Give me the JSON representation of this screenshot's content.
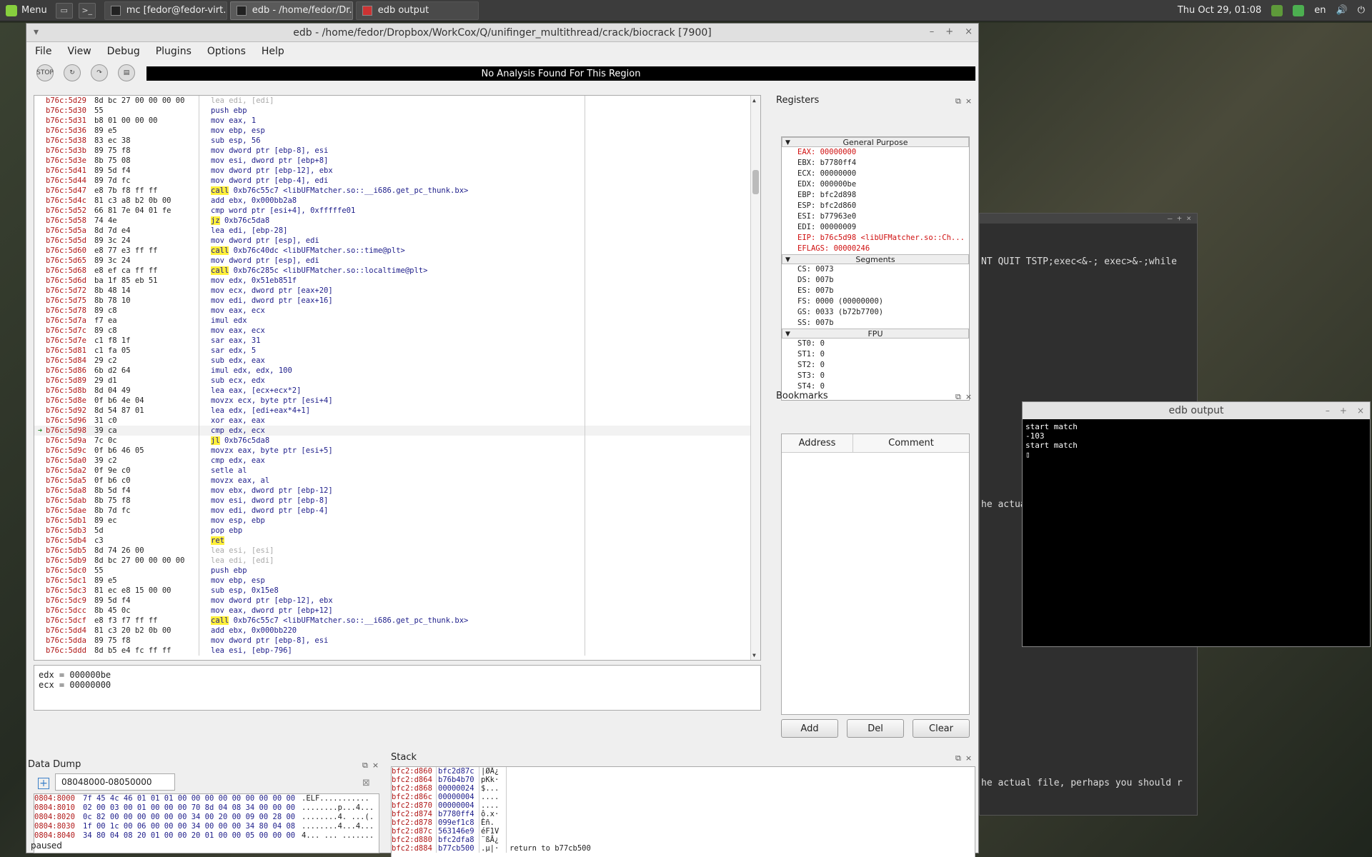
{
  "panel": {
    "menu_label": "Menu",
    "tasks": [
      "mc [fedor@fedor-virt...",
      "edb - /home/fedor/Dr...",
      "edb output"
    ],
    "clock": "Thu Oct 29, 01:08",
    "lang": "en"
  },
  "edb": {
    "title": "edb - /home/fedor/Dropbox/WorkCox/Q/unifinger_multithread/crack/biocrack [7900]",
    "menus": [
      "File",
      "View",
      "Debug",
      "Plugins",
      "Options",
      "Help"
    ],
    "analysis": "No Analysis Found For This Region",
    "disasm": [
      {
        "a": "b76c:5d29",
        "b": "8d bc 27 00 00 00 00",
        "i": "lea edi, [edi]",
        "s": "gray"
      },
      {
        "a": "b76c:5d30",
        "b": "55",
        "i": "push ebp"
      },
      {
        "a": "b76c:5d31",
        "b": "b8 01 00 00 00",
        "i": "mov eax, 1"
      },
      {
        "a": "b76c:5d36",
        "b": "89 e5",
        "i": "mov ebp, esp"
      },
      {
        "a": "b76c:5d38",
        "b": "83 ec 38",
        "i": "sub esp, 56"
      },
      {
        "a": "b76c:5d3b",
        "b": "89 75 f8",
        "i": "mov dword ptr [ebp-8], esi"
      },
      {
        "a": "b76c:5d3e",
        "b": "8b 75 08",
        "i": "mov esi, dword ptr [ebp+8]"
      },
      {
        "a": "b76c:5d41",
        "b": "89 5d f4",
        "i": "mov dword ptr [ebp-12], ebx"
      },
      {
        "a": "b76c:5d44",
        "b": "89 7d fc",
        "i": "mov dword ptr [ebp-4], edi"
      },
      {
        "a": "b76c:5d47",
        "b": "e8 7b f8 ff ff",
        "i": "call",
        "r": " 0xb76c55c7 <libUFMatcher.so::__i686.get_pc_thunk.bx>",
        "s": "hl"
      },
      {
        "a": "b76c:5d4c",
        "b": "81 c3 a8 b2 0b 00",
        "i": "add ebx, 0x000bb2a8"
      },
      {
        "a": "b76c:5d52",
        "b": "66 81 7e 04 01 fe",
        "i": "cmp word ptr [esi+4], 0xfffffe01"
      },
      {
        "a": "b76c:5d58",
        "b": "74 4e",
        "i": "jz",
        "r": " 0xb76c5da8",
        "s": "hl"
      },
      {
        "a": "b76c:5d5a",
        "b": "8d 7d e4",
        "i": "lea edi, [ebp-28]"
      },
      {
        "a": "b76c:5d5d",
        "b": "89 3c 24",
        "i": "mov dword ptr [esp], edi"
      },
      {
        "a": "b76c:5d60",
        "b": "e8 77 e3 ff ff",
        "i": "call",
        "r": " 0xb76c40dc <libUFMatcher.so::time@plt>",
        "s": "hl"
      },
      {
        "a": "b76c:5d65",
        "b": "89 3c 24",
        "i": "mov dword ptr [esp], edi"
      },
      {
        "a": "b76c:5d68",
        "b": "e8 ef ca ff ff",
        "i": "call",
        "r": " 0xb76c285c <libUFMatcher.so::localtime@plt>",
        "s": "hl"
      },
      {
        "a": "b76c:5d6d",
        "b": "ba 1f 85 eb 51",
        "i": "mov edx, 0x51eb851f"
      },
      {
        "a": "b76c:5d72",
        "b": "8b 48 14",
        "i": "mov ecx, dword ptr [eax+20]"
      },
      {
        "a": "b76c:5d75",
        "b": "8b 78 10",
        "i": "mov edi, dword ptr [eax+16]"
      },
      {
        "a": "b76c:5d78",
        "b": "89 c8",
        "i": "mov eax, ecx"
      },
      {
        "a": "b76c:5d7a",
        "b": "f7 ea",
        "i": "imul edx"
      },
      {
        "a": "b76c:5d7c",
        "b": "89 c8",
        "i": "mov eax, ecx"
      },
      {
        "a": "b76c:5d7e",
        "b": "c1 f8 1f",
        "i": "sar eax, 31"
      },
      {
        "a": "b76c:5d81",
        "b": "c1 fa 05",
        "i": "sar edx, 5"
      },
      {
        "a": "b76c:5d84",
        "b": "29 c2",
        "i": "sub edx, eax"
      },
      {
        "a": "b76c:5d86",
        "b": "6b d2 64",
        "i": "imul edx, edx, 100"
      },
      {
        "a": "b76c:5d89",
        "b": "29 d1",
        "i": "sub ecx, edx"
      },
      {
        "a": "b76c:5d8b",
        "b": "8d 04 49",
        "i": "lea eax, [ecx+ecx*2]"
      },
      {
        "a": "b76c:5d8e",
        "b": "0f b6 4e 04",
        "i": "movzx ecx, byte ptr [esi+4]"
      },
      {
        "a": "b76c:5d92",
        "b": "8d 54 87 01",
        "i": "lea edx, [edi+eax*4+1]"
      },
      {
        "a": "b76c:5d96",
        "b": "31 c0",
        "i": "xor eax, eax"
      },
      {
        "a": "b76c:5d98",
        "b": "39 ca",
        "i": "cmp edx, ecx",
        "cur": true
      },
      {
        "a": "b76c:5d9a",
        "b": "7c 0c",
        "i": "jl",
        "r": " 0xb76c5da8",
        "s": "hl"
      },
      {
        "a": "b76c:5d9c",
        "b": "0f b6 46 05",
        "i": "movzx eax, byte ptr [esi+5]"
      },
      {
        "a": "b76c:5da0",
        "b": "39 c2",
        "i": "cmp edx, eax"
      },
      {
        "a": "b76c:5da2",
        "b": "0f 9e c0",
        "i": "setle al"
      },
      {
        "a": "b76c:5da5",
        "b": "0f b6 c0",
        "i": "movzx eax, al"
      },
      {
        "a": "b76c:5da8",
        "b": "8b 5d f4",
        "i": "mov ebx, dword ptr [ebp-12]"
      },
      {
        "a": "b76c:5dab",
        "b": "8b 75 f8",
        "i": "mov esi, dword ptr [ebp-8]"
      },
      {
        "a": "b76c:5dae",
        "b": "8b 7d fc",
        "i": "mov edi, dword ptr [ebp-4]"
      },
      {
        "a": "b76c:5db1",
        "b": "89 ec",
        "i": "mov esp, ebp"
      },
      {
        "a": "b76c:5db3",
        "b": "5d",
        "i": "pop ebp"
      },
      {
        "a": "b76c:5db4",
        "b": "c3",
        "i": "ret",
        "r": "",
        "s": "hl"
      },
      {
        "a": "b76c:5db5",
        "b": "8d 74 26 00",
        "i": "lea esi, [esi]",
        "s": "gray"
      },
      {
        "a": "b76c:5db9",
        "b": "8d bc 27 00 00 00 00",
        "i": "lea edi, [edi]",
        "s": "gray"
      },
      {
        "a": "b76c:5dc0",
        "b": "55",
        "i": "push ebp"
      },
      {
        "a": "b76c:5dc1",
        "b": "89 e5",
        "i": "mov ebp, esp"
      },
      {
        "a": "b76c:5dc3",
        "b": "81 ec e8 15 00 00",
        "i": "sub esp, 0x15e8"
      },
      {
        "a": "b76c:5dc9",
        "b": "89 5d f4",
        "i": "mov dword ptr [ebp-12], ebx"
      },
      {
        "a": "b76c:5dcc",
        "b": "8b 45 0c",
        "i": "mov eax, dword ptr [ebp+12]"
      },
      {
        "a": "b76c:5dcf",
        "b": "e8 f3 f7 ff ff",
        "i": "call",
        "r": " 0xb76c55c7 <libUFMatcher.so::__i686.get_pc_thunk.bx>",
        "s": "hl"
      },
      {
        "a": "b76c:5dd4",
        "b": "81 c3 20 b2 0b 00",
        "i": "add ebx, 0x000bb220"
      },
      {
        "a": "b76c:5dda",
        "b": "89 75 f8",
        "i": "mov dword ptr [ebp-8], esi"
      },
      {
        "a": "b76c:5ddd",
        "b": "8d b5 e4 fc ff ff",
        "i": "lea esi, [ebp-796]"
      }
    ],
    "regs_text": [
      "edx = 000000be",
      "ecx = 00000000"
    ],
    "registers_title": "Registers",
    "groups": {
      "gp": "General Purpose",
      "seg": "Segments",
      "fpu": "FPU"
    },
    "gp": [
      {
        "t": "EAX: 00000000",
        "red": true
      },
      {
        "t": "EBX: b7780ff4"
      },
      {
        "t": "ECX: 00000000"
      },
      {
        "t": "EDX: 000000be"
      },
      {
        "t": "EBP: bfc2d898"
      },
      {
        "t": "ESP: bfc2d860"
      },
      {
        "t": "ESI: b77963e0"
      },
      {
        "t": "EDI: 00000009"
      },
      {
        "t": "EIP: b76c5d98 <libUFMatcher.so::Ch...",
        "red": true
      },
      {
        "t": "EFLAGS: 00000246",
        "red": true
      }
    ],
    "segs": [
      "CS: 0073",
      "DS: 007b",
      "ES: 007b",
      "FS: 0000 (00000000)",
      "GS: 0033 (b72b7700)",
      "SS: 007b"
    ],
    "fpu": [
      "ST0: 0",
      "ST1: 0",
      "ST2: 0",
      "ST3: 0",
      "ST4: 0"
    ],
    "bookmarks_title": "Bookmarks",
    "bm_cols": [
      "Address",
      "Comment"
    ],
    "bm_buttons": [
      "Add",
      "Del",
      "Clear"
    ],
    "dump_title": "Data Dump",
    "dump_tab": "08048000-08050000",
    "dump": [
      {
        "a": "0804:8000",
        "h": "7f 45 4c 46 01 01 01 00 00 00 00 00 00 00 00 00",
        "t": ".ELF..........."
      },
      {
        "a": "0804:8010",
        "h": "02 00 03 00 01 00 00 00 70 8d 04 08 34 00 00 00",
        "t": "........p...4..."
      },
      {
        "a": "0804:8020",
        "h": "0c 82 00 00 00 00 00 00 34 00 20 00 09 00 28 00",
        "t": "........4. ...(."
      },
      {
        "a": "0804:8030",
        "h": "1f 00 1c 00 06 00 00 00 34 00 00 00 34 80 04 08",
        "t": "........4...4..."
      },
      {
        "a": "0804:8040",
        "h": "34 80 04 08 20 01 00 00 20 01 00 00 05 00 00 00",
        "t": "4... ... ......."
      }
    ],
    "stack_title": "Stack",
    "stack": [
      {
        "a": "bfc2:d860",
        "v": "bfc2d87c",
        "t": "|ØÂ¿",
        "c": ""
      },
      {
        "a": "bfc2:d864",
        "v": "b76b4b70",
        "t": "pKk·",
        "c": ""
      },
      {
        "a": "bfc2:d868",
        "v": "00000024",
        "t": "$...",
        "c": ""
      },
      {
        "a": "bfc2:d86c",
        "v": "00000004",
        "t": "....",
        "c": ""
      },
      {
        "a": "bfc2:d870",
        "v": "00000004",
        "t": "....",
        "c": ""
      },
      {
        "a": "bfc2:d874",
        "v": "b7780ff4",
        "t": "ô.x·",
        "c": ""
      },
      {
        "a": "bfc2:d878",
        "v": "099ef1c8",
        "t": "Èñ.",
        "c": ""
      },
      {
        "a": "bfc2:d87c",
        "v": "563146e9",
        "t": "éF1V",
        "c": ""
      },
      {
        "a": "bfc2:d880",
        "v": "bfc2dfa8",
        "t": "¨ßÂ¿",
        "c": ""
      },
      {
        "a": "bfc2:d884",
        "v": "b77cb500",
        "t": ".µ|·",
        "c": "return to b77cb500"
      }
    ],
    "status": "paused"
  },
  "terminal": {
    "line1": "NT QUIT TSTP;exec<&-; exec>&-;while",
    "line2": "he actua",
    "line3": "he actual file, perhaps you should r"
  },
  "edb_output": {
    "title": "edb output",
    "lines": [
      "start match",
      "-103",
      "start match",
      "▯"
    ]
  }
}
